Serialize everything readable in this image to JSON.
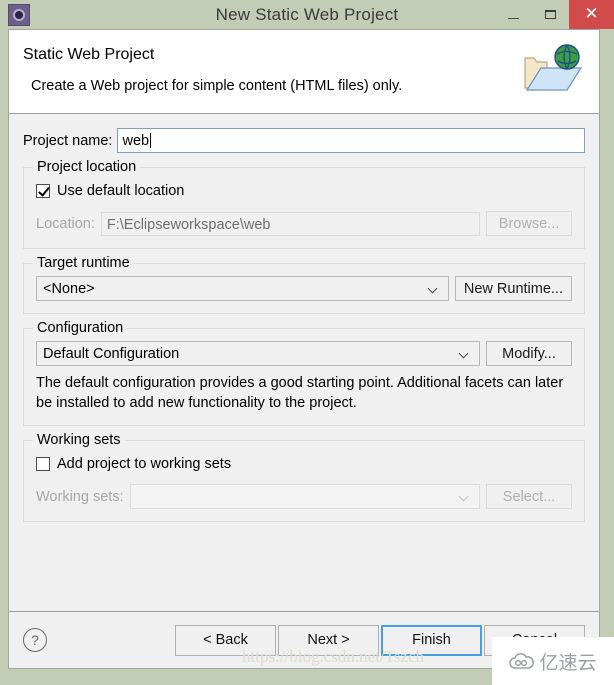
{
  "window": {
    "title": "New Static Web Project",
    "app_icon": "eclipse-icon",
    "minimize_label": "–",
    "maximize_label": "□",
    "close_label": "✕"
  },
  "header": {
    "title": "Static Web Project",
    "description": "Create a Web project for simple content (HTML files) only.",
    "icon": "web-folder-globe-icon"
  },
  "form": {
    "project_name_label": "Project name:",
    "project_name_value": "web",
    "project_location": {
      "group_label": "Project location",
      "use_default_label": "Use default location",
      "use_default_checked": true,
      "location_label": "Location:",
      "location_value": "F:\\Eclipseworkspace\\web",
      "browse_label": "Browse..."
    },
    "target_runtime": {
      "group_label": "Target runtime",
      "selected": "<None>",
      "new_runtime_label": "New Runtime..."
    },
    "configuration": {
      "group_label": "Configuration",
      "selected": "Default Configuration",
      "modify_label": "Modify...",
      "description": "The default configuration provides a good starting point. Additional facets can later be installed to add new functionality to the project."
    },
    "working_sets": {
      "group_label": "Working sets",
      "add_label": "Add project to working sets",
      "add_checked": false,
      "sets_label": "Working sets:",
      "sets_value": "",
      "select_label": "Select..."
    }
  },
  "footer": {
    "help_label": "?",
    "back_label": "< Back",
    "next_label": "Next >",
    "finish_label": "Finish",
    "cancel_label": "Cancel"
  },
  "watermarks": {
    "url": "https://blog.csdn.net/Tszch",
    "logo_text": "亿速云",
    "logo_icon": "cloud-icon"
  },
  "colors": {
    "window_frame": "#c3ccb4",
    "dialog_bg": "#f0f0f0",
    "close_button": "#d24b4b",
    "focus_border": "#4a9edd",
    "field_border": "#7ea0c4"
  }
}
